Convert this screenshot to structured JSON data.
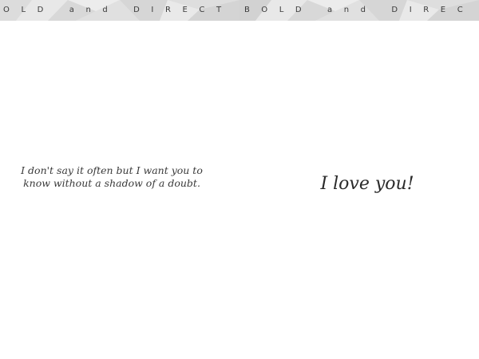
{
  "banner": {
    "text": "OLD and DIRECT",
    "text_right": "BOLD and DIREC",
    "background_color": "#e4e4e4",
    "text_color": "#3a3a3a"
  },
  "inside_left": {
    "message": "I don't say it often but I want you to know without a shadow of a doubt."
  },
  "inside_right": {
    "message": "I love you!"
  }
}
